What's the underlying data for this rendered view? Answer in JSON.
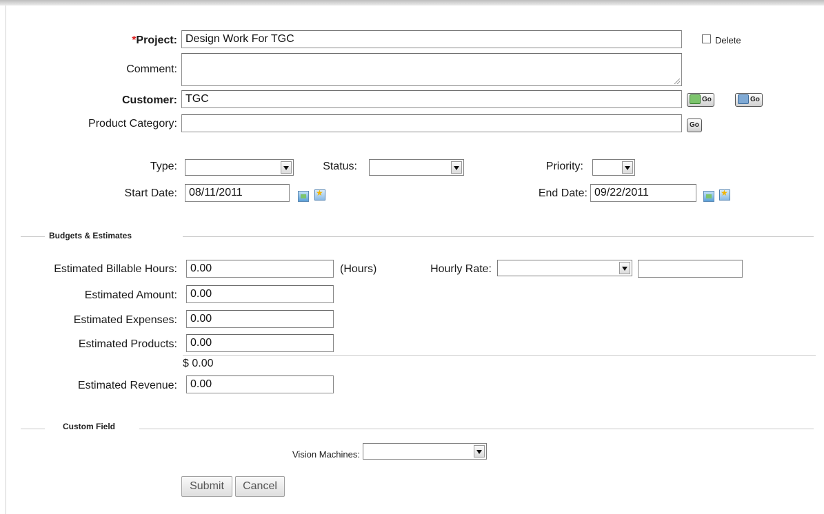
{
  "form": {
    "project": {
      "required_marker": "*",
      "label": "Project:",
      "value": "Design Work For TGC"
    },
    "delete_label": "Delete",
    "comment": {
      "label": "Comment:",
      "value": ""
    },
    "customer": {
      "label": "Customer:",
      "value": "TGC",
      "go1": "Go",
      "go2": "Go"
    },
    "product_category": {
      "label": "Product Category:",
      "value": "",
      "go": "Go"
    },
    "type": {
      "label": "Type:",
      "value": ""
    },
    "status": {
      "label": "Status:",
      "value": ""
    },
    "priority": {
      "label": "Priority:",
      "value": ""
    },
    "start_date": {
      "label": "Start Date:",
      "value": "08/11/2011"
    },
    "end_date": {
      "label": "End Date:",
      "value": "09/22/2011"
    }
  },
  "budgets": {
    "section_title": "Budgets & Estimates",
    "billable_hours": {
      "label": "Estimated Billable Hours:",
      "value": "0.00",
      "unit": "(Hours)"
    },
    "hourly_rate": {
      "label": "Hourly Rate:",
      "select_value": "",
      "value": ""
    },
    "amount": {
      "label": "Estimated Amount:",
      "value": "0.00"
    },
    "expenses": {
      "label": "Estimated Expenses:",
      "value": "0.00"
    },
    "products": {
      "label": "Estimated Products:",
      "value": "0.00"
    },
    "total": "$ 0.00",
    "revenue": {
      "label": "Estimated Revenue:",
      "value": "0.00"
    }
  },
  "custom": {
    "section_title": "Custom Field",
    "vision_machines": {
      "label": "Vision Machines:",
      "value": ""
    }
  },
  "actions": {
    "submit": "Submit",
    "cancel": "Cancel"
  },
  "icons": [
    "calendar-icon",
    "date-picker-icon",
    "customer-lookup-icon",
    "contact-lookup-icon",
    "dropdown-arrow-icon"
  ]
}
